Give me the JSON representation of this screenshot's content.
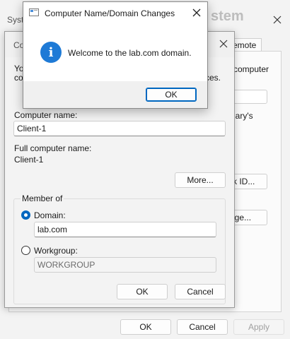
{
  "background_window": {
    "title_fragment": "Syst",
    "right_title_fragment": "stem",
    "tab_label": "emote",
    "text_computer": "computer",
    "text_library": "lary's",
    "network_id_button": "rk ID...",
    "change_button": "nge...",
    "ok_button": "OK",
    "cancel_button": "Cancel",
    "apply_button": "Apply"
  },
  "name_changes_window": {
    "title_fragment": "Co",
    "intro_fragment_1": "Yo",
    "intro_fragment_2": "co",
    "intro_suffix": "ces.",
    "computer_name_label": "Computer name:",
    "computer_name_value": "Client-1",
    "full_name_label": "Full computer name:",
    "full_name_value": "Client-1",
    "more_button": "More...",
    "member_of_label": "Member of",
    "domain_label": "Domain:",
    "domain_value": "lab.com",
    "workgroup_label": "Workgroup:",
    "workgroup_value": "WORKGROUP",
    "ok_button": "OK",
    "cancel_button": "Cancel"
  },
  "message_dialog": {
    "title": "Computer Name/Domain Changes",
    "message": "Welcome to the lab.com domain.",
    "ok_button": "OK",
    "info_icon_glyph": "i"
  },
  "colors": {
    "accent": "#0067c0",
    "info_icon": "#1e7ad6"
  }
}
